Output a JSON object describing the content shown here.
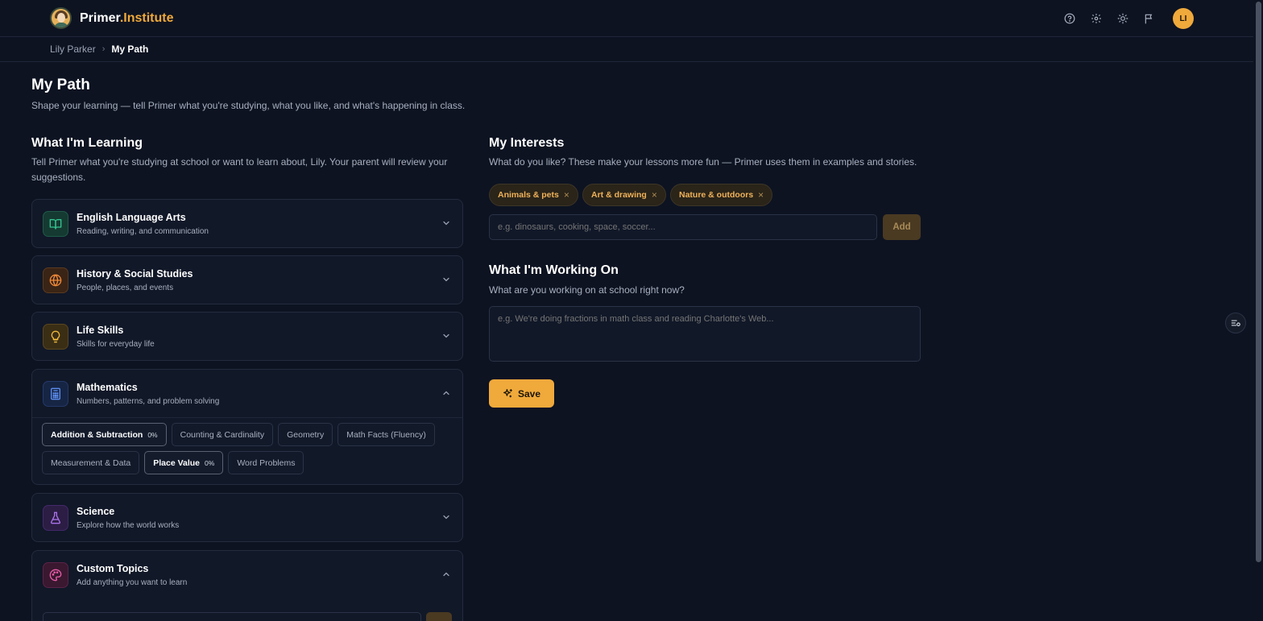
{
  "app": {
    "logo_primary": "Primer",
    "logo_accent": ".Institute",
    "avatar_initials": "LI",
    "accent_color": "#f0a93b",
    "header_icons": [
      "help-circle-icon",
      "gear-icon",
      "sun-icon",
      "flag-icon"
    ]
  },
  "breadcrumb": {
    "items": [
      "Lily Parker",
      "My Path"
    ]
  },
  "page": {
    "title": "My Path",
    "subtitle": "Shape your learning — tell Primer what you're studying, what you like, and what's happening in class."
  },
  "learning": {
    "title": "What I'm Learning",
    "description": "Tell Primer what you're studying at school or want to learn about, Lily. Your parent will review your suggestions.",
    "subjects": [
      {
        "name": "English Language Arts",
        "desc": "Reading, writing, and communication",
        "icon": "book-open-icon",
        "color": "#34c38f",
        "expanded": false
      },
      {
        "name": "History & Social Studies",
        "desc": "People, places, and events",
        "icon": "globe-icon",
        "color": "#f08a3b",
        "expanded": false
      },
      {
        "name": "Life Skills",
        "desc": "Skills for everyday life",
        "icon": "lightbulb-icon",
        "color": "#f0b93b",
        "expanded": false
      },
      {
        "name": "Mathematics",
        "desc": "Numbers, patterns, and problem solving",
        "icon": "calculator-icon",
        "color": "#5b8def",
        "expanded": true,
        "topics": [
          {
            "label": "Addition & Subtraction",
            "progress": "0%",
            "selected": true
          },
          {
            "label": "Counting & Cardinality",
            "selected": false
          },
          {
            "label": "Geometry",
            "selected": false
          },
          {
            "label": "Math Facts (Fluency)",
            "selected": false
          },
          {
            "label": "Measurement & Data",
            "selected": false
          },
          {
            "label": "Place Value",
            "progress": "0%",
            "selected": true
          },
          {
            "label": "Word Problems",
            "selected": false
          }
        ]
      },
      {
        "name": "Science",
        "desc": "Explore how the world works",
        "icon": "flask-icon",
        "color": "#a872e8",
        "expanded": false
      },
      {
        "name": "Custom Topics",
        "desc": "Add anything you want to learn",
        "icon": "palette-icon",
        "color": "#e85ca8",
        "expanded": true
      }
    ]
  },
  "interests": {
    "title": "My Interests",
    "description": "What do you like? These make your lessons more fun — Primer uses them in examples and stories.",
    "tags": [
      "Animals & pets",
      "Art & drawing",
      "Nature & outdoors"
    ],
    "remove_glyph": "×",
    "input_placeholder": "e.g. dinosaurs, cooking, space, soccer...",
    "add_label": "Add"
  },
  "working_on": {
    "title": "What I'm Working On",
    "description": "What are you working on at school right now?",
    "placeholder": "e.g. We're doing fractions in math class and reading Charlotte's Web...",
    "save_label": "Save"
  }
}
